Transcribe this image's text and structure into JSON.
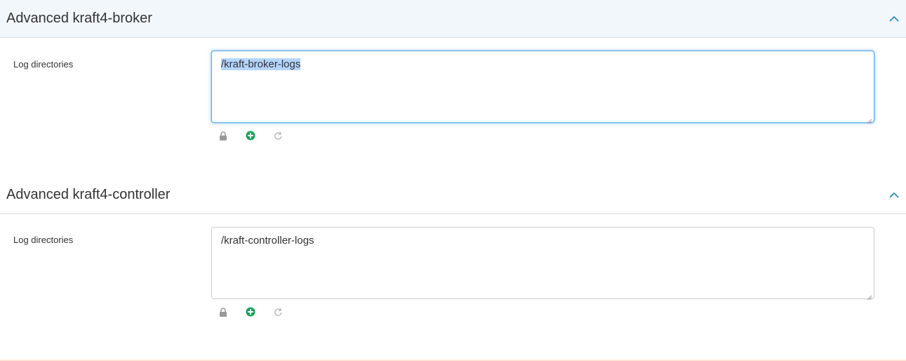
{
  "sections": [
    {
      "title": "Advanced kraft4-broker",
      "field_label": "Log directories",
      "field_value": "/kraft-broker-logs",
      "colors": {
        "header_bg": "#f2f7fc",
        "focus_border": "#66afe9",
        "selection": "#b4d5fe"
      }
    },
    {
      "title": "Advanced kraft4-controller",
      "field_label": "Log directories",
      "field_value": "/kraft-controller-logs"
    }
  ],
  "icons": {
    "collapse": "chevron-up-icon",
    "lock": "lock-icon",
    "add": "plus-circle-icon",
    "reset": "refresh-icon"
  },
  "colors": {
    "accent": "#2a8fbd",
    "add_green": "#1aa05a",
    "lock_gray": "#999999",
    "refresh_gray": "#bbbbbb"
  }
}
